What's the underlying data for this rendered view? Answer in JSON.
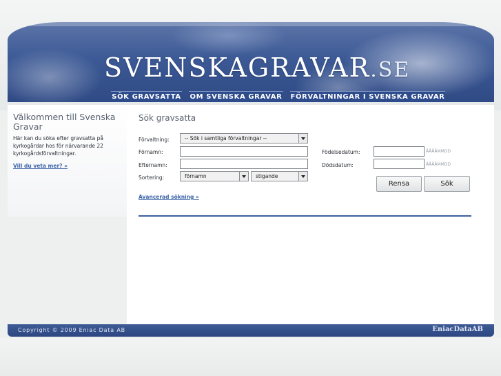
{
  "header": {
    "logo_main": "SVENSKAGRAVAR",
    "logo_tld": ".SE",
    "nav": [
      {
        "label": "SÖK GRAVSATTA"
      },
      {
        "label": "OM SVENSKA GRAVAR"
      },
      {
        "label": "FÖRVALTNINGAR I SVENSKA GRAVAR"
      }
    ]
  },
  "sidebar": {
    "title": "Välkommen till Svenska Gravar",
    "text": "Här kan du söka efter gravsatta på kyrkogårdar hos för närvarande 22 kyrkogårdsförvaltningar.",
    "link": "Vill du veta mer? »"
  },
  "search": {
    "title": "Sök gravsatta",
    "forvaltning_label": "Förvaltning:",
    "forvaltning_value": "-- Sök i samtliga förvaltningar --",
    "fornamn_label": "Förnamn:",
    "fornamn_value": "",
    "efternamn_label": "Efternamn:",
    "efternamn_value": "",
    "sortering_label": "Sortering:",
    "sort_field_value": "förnamn",
    "sort_order_value": "stigande",
    "fodelsedatum_label": "Födelsedatum:",
    "fodelsedatum_value": "",
    "fodelsedatum_hint": "ÅÅÅÅMMDD",
    "dodsdatum_label": "Dödsdatum:",
    "dodsdatum_value": "",
    "dodsdatum_hint": "ÅÅÅÅMMDD",
    "reset_label": "Rensa",
    "submit_label": "Sök",
    "advanced_link": "Avancerad sökning »"
  },
  "footer": {
    "copyright": "Copyright © 2009 Eniac Data AB",
    "brand": "EniacDataAB"
  },
  "colors": {
    "header_blue": "#3d5a96",
    "nav_blue": "#2e4c8c",
    "link_blue": "#3c64a8",
    "rule_blue": "#3a5f9c"
  }
}
